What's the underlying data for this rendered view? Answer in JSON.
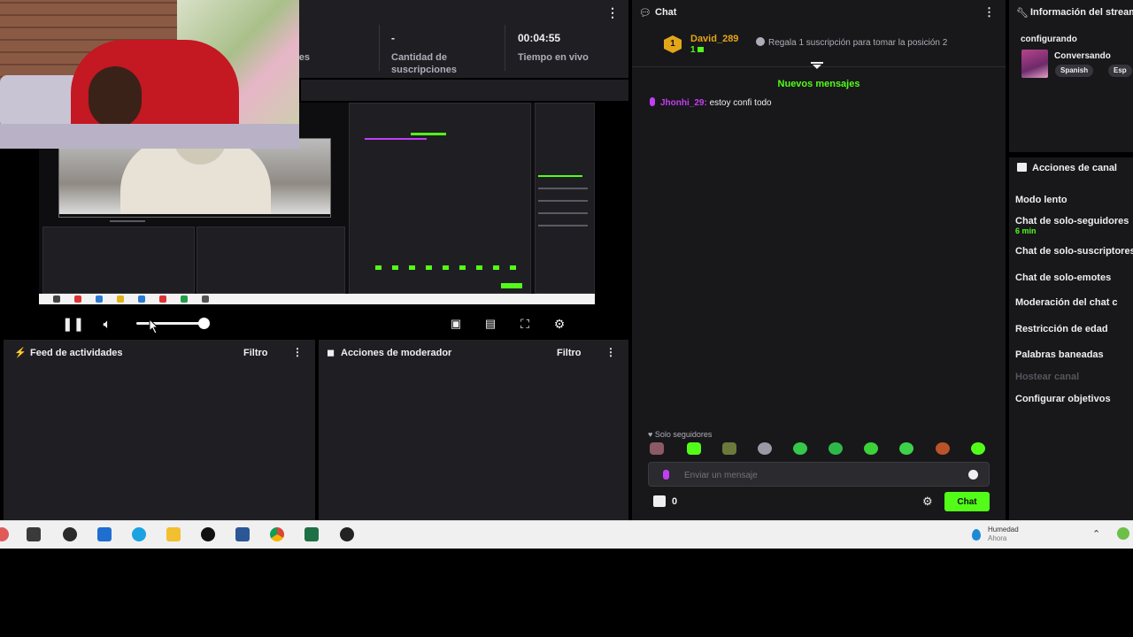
{
  "stats": {
    "followers_label": "dores",
    "subs_value": "-",
    "subs_label": "Cantidad de suscripciones",
    "live_value": "00:04:55",
    "live_label": "Tiempo en vivo"
  },
  "panels": {
    "activity_feed": {
      "title": "Feed de actividades",
      "filter": "Filtro"
    },
    "mod_actions": {
      "title": "Acciones de moderador",
      "filter": "Filtro"
    }
  },
  "chat": {
    "title": "Chat",
    "pinned": {
      "badge_num": "1",
      "user": "David_289",
      "count": "1",
      "text": "Regala 1 suscripción para tomar la posición 2"
    },
    "new_messages": "Nuevos mensajes",
    "messages": [
      {
        "user": "Jhonhi_29:",
        "text": "estoy confi todo"
      }
    ],
    "followers_only": "Solo seguidores",
    "input_placeholder": "Enviar un mensaje",
    "points": "0",
    "send_label": "Chat"
  },
  "info": {
    "title": "Información del stream",
    "status": "configurando",
    "category": "Conversando",
    "tags": [
      "Spanish",
      "Esp"
    ]
  },
  "actions": {
    "title": "Acciones de canal",
    "items": [
      "Modo lento",
      "Chat de solo-seguidores",
      "Chat de solo-suscriptores",
      "Chat de solo-emotes",
      "Moderación del chat c",
      "Restricción de edad",
      "Palabras baneadas",
      "Hostear canal",
      "Configurar objetivos"
    ],
    "followers_sub": "6 min"
  },
  "taskbar": {
    "weather_title": "Humedad",
    "weather_sub": "Ahora"
  },
  "icons": [
    "pause-icon",
    "volume-icon",
    "theater-icon",
    "clip-icon",
    "fullscreen-icon",
    "settings-icon",
    "bolt-icon",
    "shield-icon",
    "chat-icon",
    "wrench-icon",
    "store-icon",
    "gear-icon"
  ],
  "colors": {
    "accent": "#53fc18",
    "bg": "#18181b",
    "panel": "#1f1f23",
    "gift": "#e3a51a",
    "user": "#c33ef3"
  }
}
